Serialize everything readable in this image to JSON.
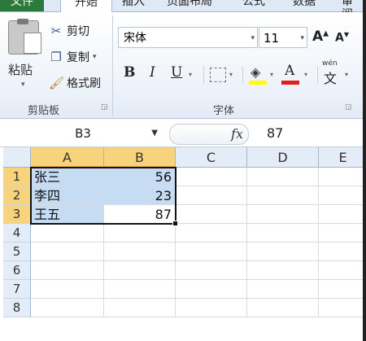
{
  "tabs": {
    "file": "文件",
    "home": "开始",
    "insert": "插入",
    "layout": "页面布局",
    "formula": "公式",
    "data": "数据",
    "review": "审阅"
  },
  "clipboard": {
    "paste": "粘贴",
    "cut": "剪切",
    "copy": "复制",
    "format_painter": "格式刷",
    "group_label": "剪贴板"
  },
  "font": {
    "name": "宋体",
    "size": "11",
    "bold": "B",
    "italic": "I",
    "underline": "U",
    "grow": "A",
    "shrink": "A",
    "font_color": "A",
    "phonetic": "wén",
    "phonetic_char": "文",
    "group_label": "字体"
  },
  "formula_bar": {
    "name_box": "B3",
    "fx": "fx",
    "value": "87"
  },
  "columns": [
    "A",
    "B",
    "C",
    "D",
    "E"
  ],
  "rows": [
    "1",
    "2",
    "3",
    "4",
    "5",
    "6",
    "7",
    "8"
  ],
  "cells": [
    {
      "a": "张三",
      "b": "56"
    },
    {
      "a": "李四",
      "b": "23"
    },
    {
      "a": "王五",
      "b": "87"
    }
  ],
  "colors": {
    "selection_fill": "#c6dcf3",
    "header_selected": "#f7d37b",
    "file_tab": "#2c7a3b",
    "highlight_yellow": "#ffff00",
    "font_red": "#e02020"
  }
}
